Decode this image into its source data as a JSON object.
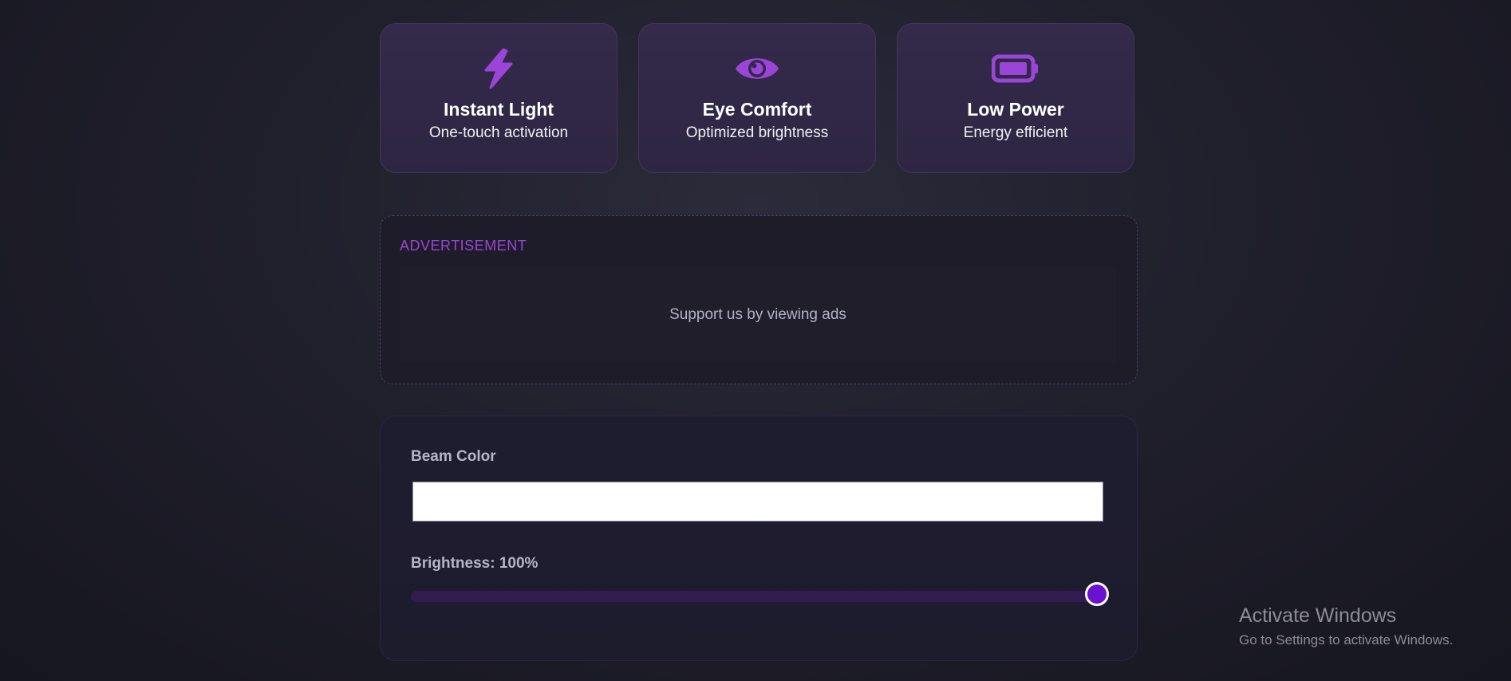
{
  "colors": {
    "accent": "#9b45d8",
    "slider_thumb": "#6a12d0",
    "beam_color": "#ffffff"
  },
  "features": [
    {
      "icon": "bolt-icon",
      "title": "Instant Light",
      "subtitle": "One-touch activation"
    },
    {
      "icon": "eye-icon",
      "title": "Eye Comfort",
      "subtitle": "Optimized brightness"
    },
    {
      "icon": "battery-icon",
      "title": "Low Power",
      "subtitle": "Energy efficient"
    }
  ],
  "ad": {
    "label": "ADVERTISEMENT",
    "message": "Support us by viewing ads"
  },
  "controls": {
    "beam_color_label": "Beam Color",
    "beam_color_value": "#ffffff",
    "brightness_label": "Brightness: 100%",
    "brightness_value": 100
  },
  "watermark": {
    "title": "Activate Windows",
    "subtitle": "Go to Settings to activate Windows."
  }
}
